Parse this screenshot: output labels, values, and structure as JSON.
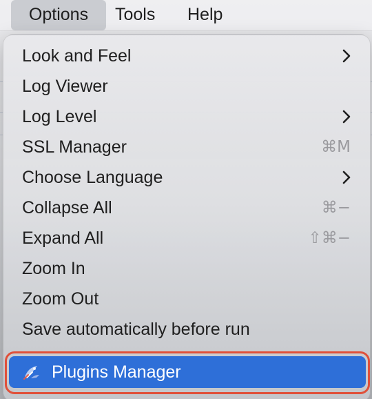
{
  "menubar": {
    "items": [
      {
        "label": "Options",
        "active": true
      },
      {
        "label": "Tools",
        "active": false
      },
      {
        "label": "Help",
        "active": false
      }
    ]
  },
  "options_menu": {
    "items": [
      {
        "label": "Look and Feel",
        "shortcut": "",
        "submenu": true
      },
      {
        "label": "Log Viewer",
        "shortcut": "",
        "submenu": false
      },
      {
        "label": "Log Level",
        "shortcut": "",
        "submenu": true
      },
      {
        "label": "SSL Manager",
        "shortcut": "⌘M",
        "submenu": false
      },
      {
        "label": "Choose Language",
        "shortcut": "",
        "submenu": true
      },
      {
        "label": "Collapse All",
        "shortcut": "⌘−",
        "submenu": false
      },
      {
        "label": "Expand All",
        "shortcut": "⇧⌘−",
        "submenu": false
      },
      {
        "label": "Zoom In",
        "shortcut": "",
        "submenu": false
      },
      {
        "label": "Zoom Out",
        "shortcut": "",
        "submenu": false
      },
      {
        "label": "Save automatically before run",
        "shortcut": "",
        "submenu": false
      }
    ],
    "highlighted_item": {
      "label": "Plugins Manager",
      "icon": "plugins-manager-icon",
      "highlight_color": "#2e6fd8",
      "annotation_ring_color": "#e0503a"
    }
  }
}
